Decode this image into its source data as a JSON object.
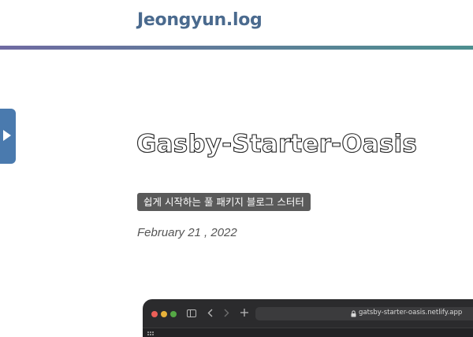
{
  "header": {
    "site_title": "Jeongyun.log"
  },
  "post": {
    "title": "Gasby-Starter-Oasis",
    "tag": "쉽게 시작하는 풀 패키지 블로그 스터터",
    "date": "February 21 , 2022"
  },
  "browser": {
    "address": "gatsby-starter-oasis.netlify.app"
  },
  "colors": {
    "site_title": "#4a6a8e",
    "gradient_start": "#6f6aa2",
    "gradient_end": "#4d8f8f",
    "sidebar_toggle": "#4a7aae",
    "tag_bg": "#5a5a5a"
  },
  "icons": {
    "sidebar_toggle": "triangle-right-icon",
    "browser": [
      "sidebar-icon",
      "chevron-left-icon",
      "chevron-right-icon",
      "plus-icon",
      "lock-icon",
      "grid-icon"
    ]
  }
}
